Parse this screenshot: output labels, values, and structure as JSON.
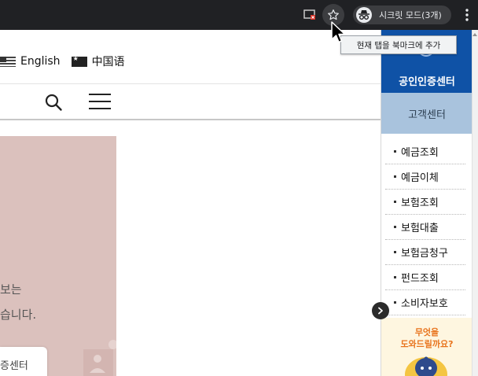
{
  "browser": {
    "incognito_label": "시크릿 모드(3개)",
    "tooltip": "현재 탭을 북마크에 추가"
  },
  "header": {
    "lang_english": "English",
    "lang_chinese": "中国语"
  },
  "banner": {
    "text_line1": "보는",
    "text_line2": "습니다.",
    "card_label": "증센터"
  },
  "right_panel": {
    "cert_center": "공인인증센터",
    "customer_center": "고객센터",
    "menu": [
      {
        "label": "예금조회"
      },
      {
        "label": "예금이체"
      },
      {
        "label": "보험조회"
      },
      {
        "label": "보험대출"
      },
      {
        "label": "보험금청구"
      },
      {
        "label": "펀드조회"
      },
      {
        "label": "소비자보호"
      }
    ],
    "promo_line1": "무엇을",
    "promo_line2": "도와드릴까요?"
  },
  "colors": {
    "toolbar": "#202124",
    "cert_blue": "#0f52a6",
    "service_blue": "#a9c3dd",
    "banner_pink": "#dbc1bd",
    "promo_orange": "#e8731c"
  },
  "icons": [
    "cast-icon",
    "bookmark-star-icon",
    "incognito-icon",
    "kebab-menu-icon",
    "search-icon",
    "hamburger-menu-icon",
    "chevron-right-icon"
  ]
}
